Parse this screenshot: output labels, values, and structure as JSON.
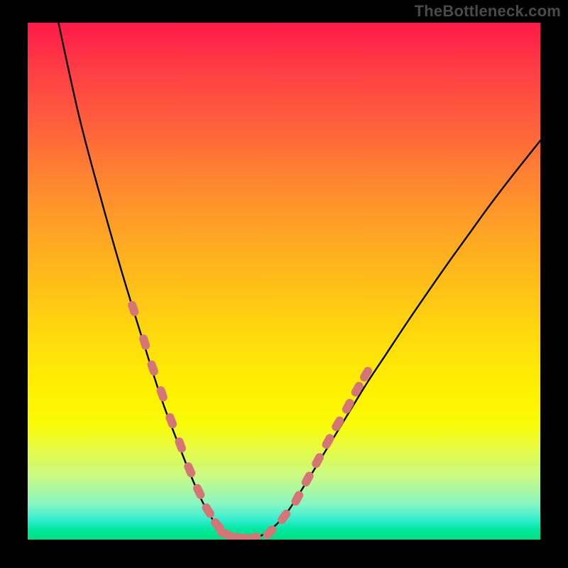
{
  "watermark": "TheBottleneck.com",
  "chart_data": {
    "type": "line",
    "title": "",
    "xlabel": "",
    "ylabel": "",
    "xlim": [
      0,
      1
    ],
    "ylim": [
      0,
      1
    ],
    "series": [
      {
        "name": "curve",
        "color": "#000000",
        "x": [
          0.06,
          0.1,
          0.14,
          0.18,
          0.22,
          0.26,
          0.292,
          0.32,
          0.34,
          0.36,
          0.38,
          0.405,
          0.43,
          0.46,
          0.5,
          0.54,
          0.58,
          0.62,
          0.66,
          0.7,
          0.74,
          0.78,
          0.82,
          0.86,
          0.9,
          0.94,
          0.98,
          1.0
        ],
        "y": [
          1.0,
          0.82,
          0.67,
          0.53,
          0.4,
          0.275,
          0.19,
          0.12,
          0.075,
          0.04,
          0.014,
          0.003,
          0.003,
          0.01,
          0.045,
          0.105,
          0.17,
          0.235,
          0.3,
          0.36,
          0.42,
          0.478,
          0.535,
          0.59,
          0.645,
          0.697,
          0.747,
          0.772
        ]
      }
    ],
    "markers": {
      "name": "highlighted-points",
      "color": "#d57676",
      "x": [
        0.206,
        0.228,
        0.244,
        0.262,
        0.28,
        0.298,
        0.316,
        0.334,
        0.352,
        0.37,
        0.384,
        0.402,
        0.42,
        0.44,
        0.472,
        0.5,
        0.526,
        0.546,
        0.566,
        0.586,
        0.605,
        0.625,
        0.643,
        0.66
      ],
      "y": [
        0.447,
        0.382,
        0.332,
        0.282,
        0.23,
        0.183,
        0.135,
        0.093,
        0.056,
        0.028,
        0.012,
        0.005,
        0.003,
        0.003,
        0.014,
        0.044,
        0.08,
        0.117,
        0.153,
        0.19,
        0.224,
        0.258,
        0.291,
        0.32
      ]
    },
    "gradient_bands": [
      {
        "name": "red",
        "y_from": 1.0,
        "y_to": 0.55
      },
      {
        "name": "orange",
        "y_from": 0.55,
        "y_to": 0.3
      },
      {
        "name": "yellow",
        "y_from": 0.3,
        "y_to": 0.08
      },
      {
        "name": "green",
        "y_from": 0.08,
        "y_to": 0.0
      }
    ]
  }
}
